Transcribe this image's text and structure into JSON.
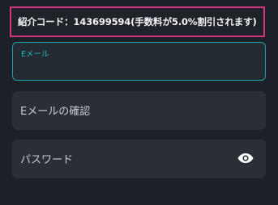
{
  "referral": {
    "text": "紹介コード：143699594(手数料が5.0%割引されます)"
  },
  "form": {
    "email": {
      "label": "Eメール",
      "value": ""
    },
    "email_confirm": {
      "label": "Eメールの確認",
      "value": ""
    },
    "password": {
      "label": "パスワード",
      "value": "",
      "toggle_icon": "eye-icon"
    }
  },
  "colors": {
    "background": "#1c2027",
    "field_background": "#2a2f36",
    "focus_accent": "#1aa2a6",
    "banner_border": "#d1367f"
  }
}
